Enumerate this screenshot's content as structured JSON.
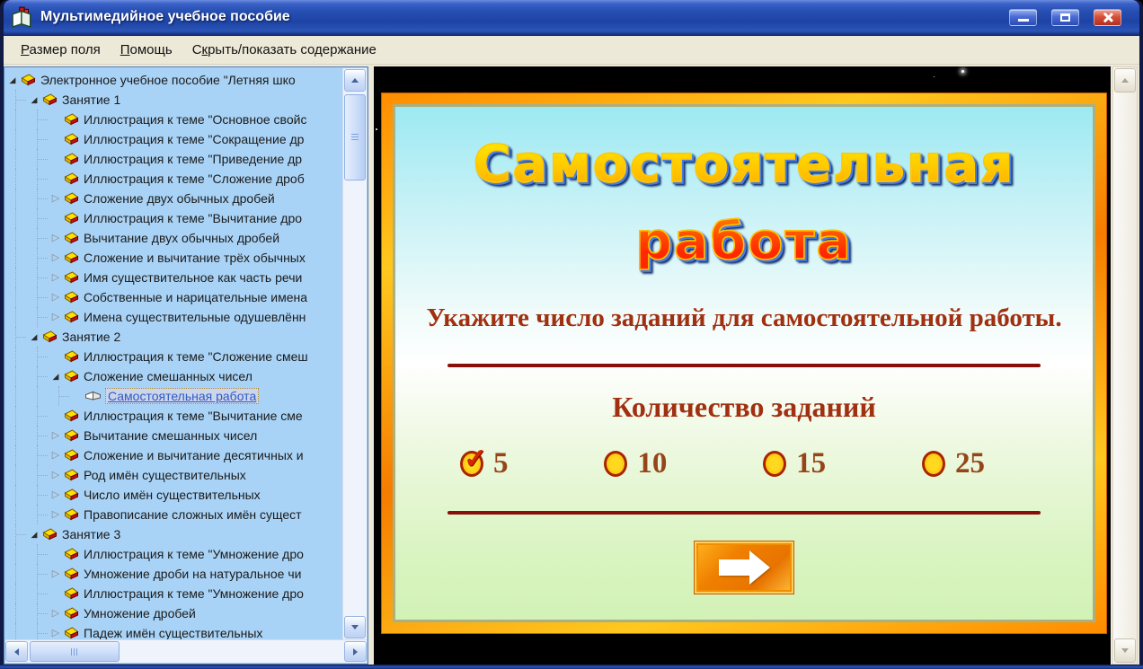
{
  "window": {
    "title": "Мультимедийное учебное пособие",
    "controls": [
      "minimize",
      "maximize",
      "close"
    ]
  },
  "menu": {
    "items": [
      {
        "name": "field-size",
        "label": "Размер поля",
        "underline_index": 0
      },
      {
        "name": "help",
        "label": "Помощь",
        "underline_index": 0
      },
      {
        "name": "toggle-contents",
        "label": "Скрыть/показать содержание",
        "underline_index": 1
      }
    ]
  },
  "tree": {
    "items": [
      {
        "level": 0,
        "expander": "expanded",
        "icon": "book-closed-icon",
        "label": "Электронное учебное пособие \"Летняя шко"
      },
      {
        "level": 1,
        "expander": "expanded",
        "icon": "book-closed-icon",
        "label": "Занятие 1"
      },
      {
        "level": 2,
        "expander": "none",
        "icon": "book-closed-icon",
        "label": "Иллюстрация к теме \"Основное свойс"
      },
      {
        "level": 2,
        "expander": "none",
        "icon": "book-closed-icon",
        "label": "Иллюстрация к теме \"Сокращение др"
      },
      {
        "level": 2,
        "expander": "none",
        "icon": "book-closed-icon",
        "label": "Иллюстрация к теме \"Приведение др"
      },
      {
        "level": 2,
        "expander": "none",
        "icon": "book-closed-icon",
        "label": "Иллюстрация к теме \"Сложение дроб"
      },
      {
        "level": 2,
        "expander": "collapsed",
        "icon": "book-closed-icon",
        "label": "Сложение двух обычных дробей"
      },
      {
        "level": 2,
        "expander": "none",
        "icon": "book-closed-icon",
        "label": "Иллюстрация к теме \"Вычитание дро"
      },
      {
        "level": 2,
        "expander": "collapsed",
        "icon": "book-closed-icon",
        "label": "Вычитание двух обычных дробей"
      },
      {
        "level": 2,
        "expander": "collapsed",
        "icon": "book-closed-icon",
        "label": "Сложение и вычитание трёх обычных"
      },
      {
        "level": 2,
        "expander": "collapsed",
        "icon": "book-closed-icon",
        "label": "Имя существительное как часть речи"
      },
      {
        "level": 2,
        "expander": "collapsed",
        "icon": "book-closed-icon",
        "label": "Собственные и нарицательные имена"
      },
      {
        "level": 2,
        "expander": "collapsed",
        "icon": "book-closed-icon",
        "label": "Имена существительные одушевлённ"
      },
      {
        "level": 1,
        "expander": "expanded",
        "icon": "book-closed-icon",
        "label": "Занятие 2"
      },
      {
        "level": 2,
        "expander": "none",
        "icon": "book-closed-icon",
        "label": "Иллюстрация к теме \"Сложение смеш"
      },
      {
        "level": 2,
        "expander": "expanded",
        "icon": "book-closed-icon",
        "label": "Сложение смешанных чисел"
      },
      {
        "level": 3,
        "expander": "none",
        "icon": "book-open-icon",
        "label": "Самостоятельная работа",
        "selected": true
      },
      {
        "level": 2,
        "expander": "none",
        "icon": "book-closed-icon",
        "label": "Иллюстрация к теме \"Вычитание сме"
      },
      {
        "level": 2,
        "expander": "collapsed",
        "icon": "book-closed-icon",
        "label": "Вычитание смешанных чисел"
      },
      {
        "level": 2,
        "expander": "collapsed",
        "icon": "book-closed-icon",
        "label": "Сложение и вычитание десятичных и"
      },
      {
        "level": 2,
        "expander": "collapsed",
        "icon": "book-closed-icon",
        "label": "Род имён существительных"
      },
      {
        "level": 2,
        "expander": "collapsed",
        "icon": "book-closed-icon",
        "label": "Число имён существительных"
      },
      {
        "level": 2,
        "expander": "collapsed",
        "icon": "book-closed-icon",
        "label": "Правописание сложных имён сущест"
      },
      {
        "level": 1,
        "expander": "expanded",
        "icon": "book-closed-icon",
        "label": "Занятие 3"
      },
      {
        "level": 2,
        "expander": "none",
        "icon": "book-closed-icon",
        "label": "Иллюстрация к теме \"Умножение дро"
      },
      {
        "level": 2,
        "expander": "collapsed",
        "icon": "book-closed-icon",
        "label": "Умножение дроби на натуральное чи"
      },
      {
        "level": 2,
        "expander": "none",
        "icon": "book-closed-icon",
        "label": "Иллюстрация к теме \"Умножение дро"
      },
      {
        "level": 2,
        "expander": "collapsed",
        "icon": "book-closed-icon",
        "label": "Умножение дробей"
      },
      {
        "level": 2,
        "expander": "collapsed",
        "icon": "book-closed-icon",
        "label": "Падеж имён существительных"
      }
    ]
  },
  "content": {
    "title_lines": [
      "Самостоятельная",
      "работа"
    ],
    "prompt": "Укажите число заданий для самостоятельной работы.",
    "group_label": "Количество заданий",
    "options": [
      {
        "label": "5",
        "checked": true
      },
      {
        "label": "10",
        "checked": false
      },
      {
        "label": "15",
        "checked": false
      },
      {
        "label": "25",
        "checked": false
      }
    ],
    "next_button_icon": "arrow-right-icon"
  },
  "colors": {
    "titlebar_blue": "#2750b4",
    "menubar_beige": "#ece9d8",
    "tree_bg": "#a9d3f6",
    "card_border_orange": "#f57c00",
    "card_top_cyan": "#9de9f2",
    "card_bottom_green": "#d2f2b6",
    "dark_red": "#8a0f08",
    "text_red_brown": "#a03010",
    "radio_yellow": "#ffc800",
    "button_orange": "#f08000"
  }
}
